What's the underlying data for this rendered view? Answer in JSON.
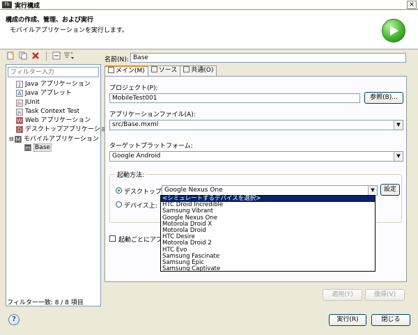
{
  "window": {
    "app_icon": "Fb",
    "title": "実行構成",
    "close_glyph": "×"
  },
  "header": {
    "title": "構成の作成、管理、および実行",
    "subtitle": "モバイルアプリケーションを実行します。",
    "run_icon": "run-play-icon"
  },
  "left": {
    "filter_placeholder": "フィルター入力",
    "tree": [
      {
        "label": "Java アプリケーション",
        "icon": "J",
        "color": "#4a6fb0"
      },
      {
        "label": "Java アプレット",
        "icon": "A",
        "color": "#4a6fb0"
      },
      {
        "label": "JUnit",
        "icon": "Ju",
        "color": "#9a3a2a"
      },
      {
        "label": "Task Context Test",
        "icon": "Ju",
        "color": "#9a3a2a"
      },
      {
        "label": "Web アプリケーション",
        "icon": "W",
        "color": "#c43131"
      },
      {
        "label": "デスクトップアプリケーション",
        "icon": "D",
        "color": "#c43131"
      },
      {
        "label": "モバイルアプリケーション",
        "icon": "M",
        "color": "#555555"
      },
      {
        "label": "Base",
        "icon": "m",
        "color": "#555555"
      }
    ],
    "status": "フィルター一致: 8 / 8 項目"
  },
  "config": {
    "name_label": "名前(N):",
    "name_value": "Base",
    "tabs": [
      "メイン(M)",
      "ソース",
      "共通(O)"
    ],
    "project_label": "プロジェクト(P):",
    "project_value": "MobileTest001",
    "browse_button": "参照(B)...",
    "app_file_label": "アプリケーションファイル(A):",
    "app_file_value": "src/Base.mxml",
    "platform_label": "ターゲットプラットフォーム:",
    "platform_value": "Google Android",
    "launch_group": "起動方法:",
    "desktop_radio": "デスクトップ上:",
    "desktop_device": "Google Nexus One",
    "settings_button": "設定",
    "device_radio": "デバイス上:",
    "install_checkbox": "起動ごとにアプリケ",
    "apply_button": "適用(Y)",
    "revert_button": "復帰(V)"
  },
  "device_dropdown": [
    "<シミュレートするデバイスを選択>",
    "HTC Droid Incredible",
    "Samsung Vibrant",
    "Google Nexus One",
    "Motorola Droid X",
    "Motorola Droid",
    "HTC Desire",
    "Motorola Droid 2",
    "HTC Evo",
    "Samsung Fascinate",
    "Samsung Epic",
    "Samsung Captivate"
  ],
  "footer": {
    "help_glyph": "?",
    "run_button": "実行(R)",
    "close_button": "閉じる"
  }
}
